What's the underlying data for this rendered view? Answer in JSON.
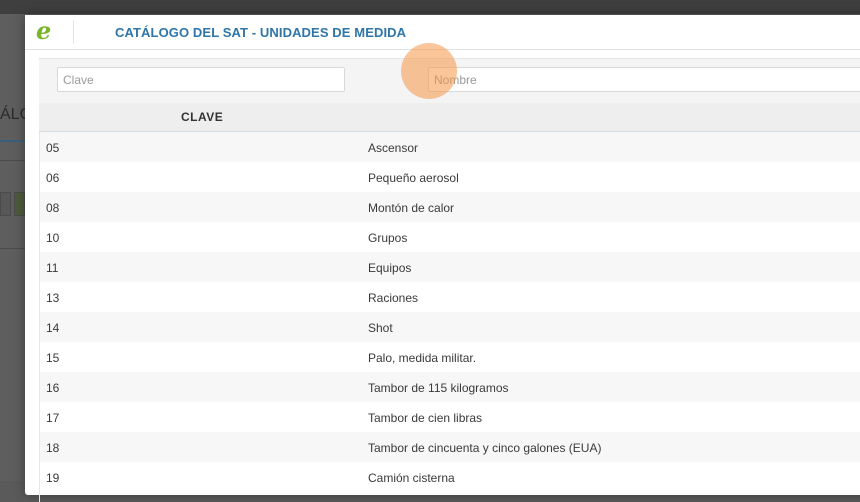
{
  "background": {
    "page_title_fragment": "ÁLO"
  },
  "modal": {
    "logo_text": "e",
    "title": "CATÁLOGO DEL SAT - UNIDADES DE MEDIDA"
  },
  "filters": {
    "clave_placeholder": "Clave",
    "nombre_placeholder": "Nombre"
  },
  "table": {
    "columns": [
      "CLAVE",
      ""
    ],
    "rows": [
      {
        "clave": "05",
        "nombre": "Ascensor"
      },
      {
        "clave": "06",
        "nombre": "Pequeño aerosol"
      },
      {
        "clave": "08",
        "nombre": "Montón de calor"
      },
      {
        "clave": "10",
        "nombre": "Grupos"
      },
      {
        "clave": "11",
        "nombre": "Equipos"
      },
      {
        "clave": "13",
        "nombre": "Raciones"
      },
      {
        "clave": "14",
        "nombre": "Shot"
      },
      {
        "clave": "15",
        "nombre": "Palo, medida militar."
      },
      {
        "clave": "16",
        "nombre": "Tambor de 115 kilogramos"
      },
      {
        "clave": "17",
        "nombre": "Tambor de cien libras"
      },
      {
        "clave": "18",
        "nombre": "Tambor de cincuenta y cinco galones (EUA)"
      },
      {
        "clave": "19",
        "nombre": "Camión cisterna"
      }
    ]
  },
  "colors": {
    "title_blue": "#2e75a8",
    "logo_green": "#7ab52b",
    "cursor_highlight": "#f59646"
  }
}
